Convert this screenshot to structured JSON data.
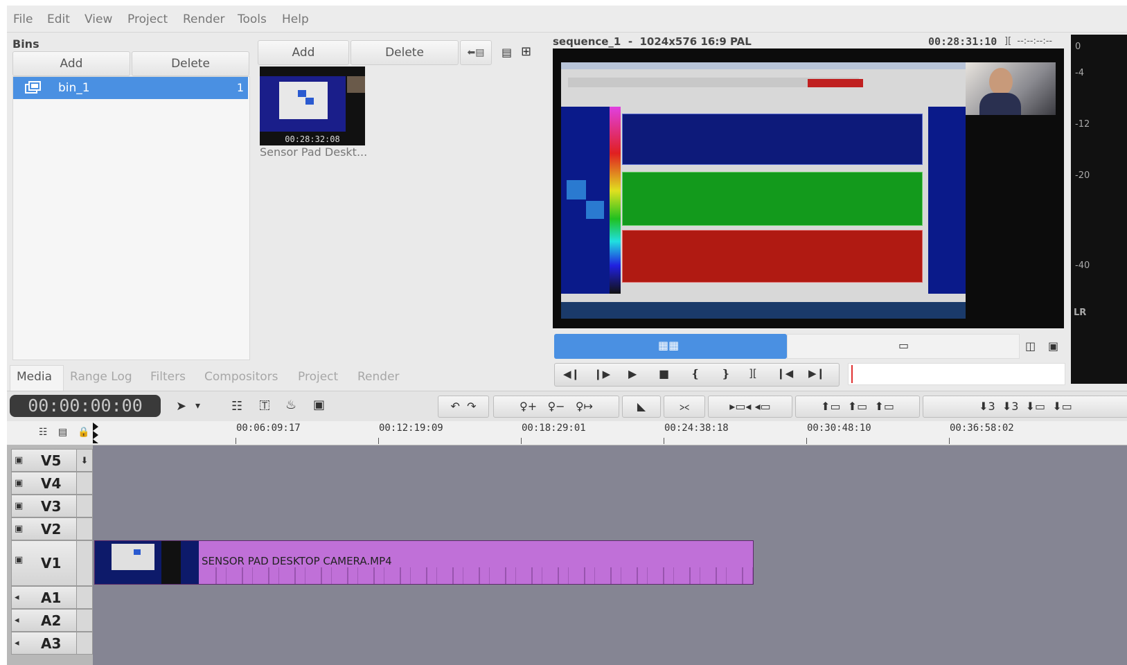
{
  "menu": [
    "File",
    "Edit",
    "View",
    "Project",
    "Render",
    "Tools",
    "Help"
  ],
  "bins": {
    "title": "Bins",
    "add_label": "Add",
    "delete_label": "Delete",
    "items": [
      {
        "name": "bin_1",
        "count": "1"
      }
    ]
  },
  "media": {
    "add_label": "Add",
    "delete_label": "Delete",
    "clip": {
      "timecode": "00:28:32:08",
      "name": "Sensor Pad Deskt..."
    }
  },
  "tabs": [
    "Media",
    "Range Log",
    "Filters",
    "Compositors",
    "Project",
    "Render"
  ],
  "monitor": {
    "sequence_info": "sequence_1  -  1024x576 16:9 PAL",
    "timecode": "00:28:31:10",
    "mark_in_out": "][  --:--:--:--",
    "meter_labels": [
      "0",
      "-4",
      "-12",
      "-20",
      "-40",
      "LR"
    ]
  },
  "timeline": {
    "position": "00:00:00:00",
    "ruler": [
      "00:06:09:17",
      "00:12:19:09",
      "00:18:29:01",
      "00:24:38:18",
      "00:30:48:10",
      "00:36:58:02"
    ],
    "tracks": [
      "V5",
      "V4",
      "V3",
      "V2",
      "V1",
      "A1",
      "A2",
      "A3"
    ],
    "clip_name": "SENSOR PAD DESKTOP CAMERA.MP4"
  },
  "colors": {
    "selection": "#4a90e2",
    "clip": "#c070d8",
    "timeline_bg": "#858593",
    "playhead": "#e03030"
  }
}
